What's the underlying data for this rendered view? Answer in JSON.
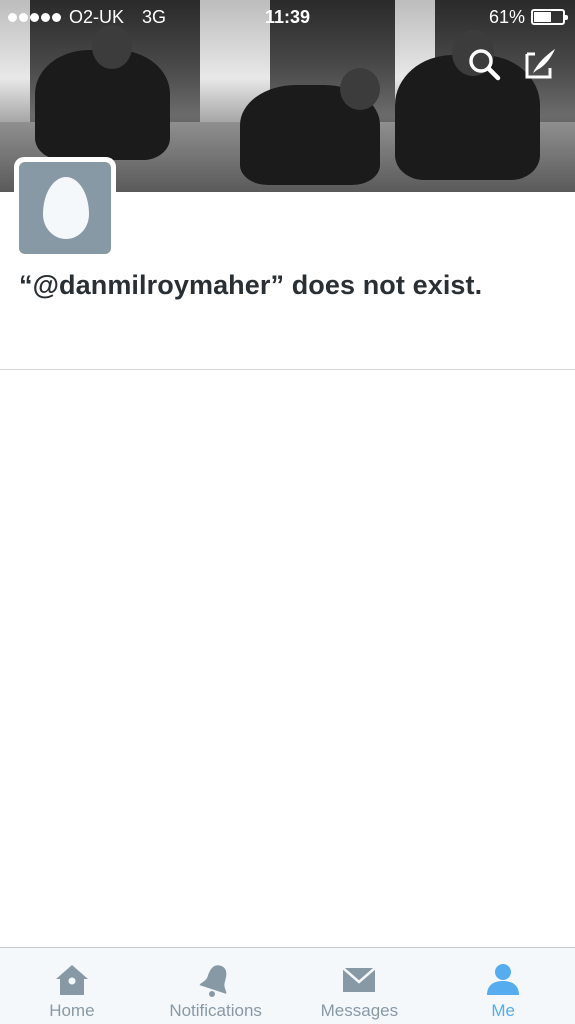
{
  "status_bar": {
    "carrier": "O2-UK",
    "network": "3G",
    "time": "11:39",
    "battery_percent_label": "61%",
    "battery_level": 0.61
  },
  "header": {
    "icons": [
      "search-icon",
      "compose-tweet-icon"
    ]
  },
  "profile": {
    "avatar_icon": "default-egg-avatar",
    "message": "“@danmilroymaher” does not exist."
  },
  "tabs": [
    {
      "label": "Home",
      "icon": "home-icon",
      "active": false
    },
    {
      "label": "Notifications",
      "icon": "bell-icon",
      "active": false
    },
    {
      "label": "Messages",
      "icon": "envelope-icon",
      "active": false
    },
    {
      "label": "Me",
      "icon": "person-icon",
      "active": true
    }
  ],
  "colors": {
    "accent": "#55acee",
    "tab_inactive": "#8899a6",
    "avatar_bg": "#8899a6",
    "text": "#292f33"
  }
}
